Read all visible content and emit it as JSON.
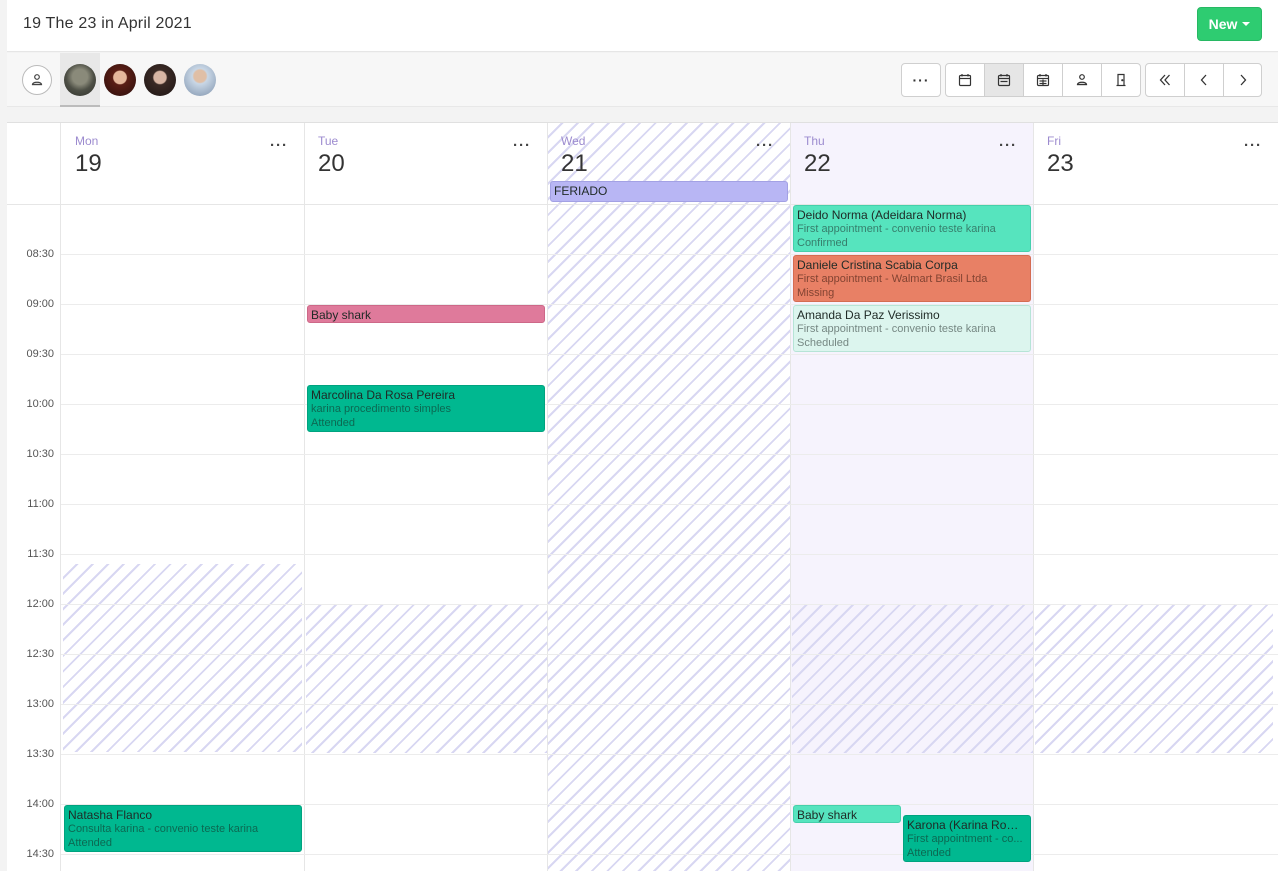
{
  "header": {
    "title": "19 The 23 in April 2021",
    "new_label": "New"
  },
  "toolbar": {
    "more_label": "···",
    "views": [
      {
        "icon": "calendar-day-icon"
      },
      {
        "icon": "calendar-week-icon",
        "selected": true
      },
      {
        "icon": "calendar-month-icon"
      },
      {
        "icon": "professional-view-icon"
      },
      {
        "icon": "room-view-icon"
      }
    ],
    "nav": [
      "double-chevron-left-icon",
      "chevron-left-icon",
      "chevron-right-icon"
    ]
  },
  "calendar": {
    "day_menu": "···",
    "days": [
      {
        "name": "Mon",
        "number": "19"
      },
      {
        "name": "Tue",
        "number": "20"
      },
      {
        "name": "Wed",
        "number": "21"
      },
      {
        "name": "Thu",
        "number": "22"
      },
      {
        "name": "Fri",
        "number": "23"
      }
    ],
    "times": [
      "08:30",
      "09:00",
      "09:30",
      "10:00",
      "10:30",
      "11:00",
      "11:30",
      "12:00",
      "12:30",
      "13:00",
      "13:30",
      "14:00",
      "14:30"
    ],
    "events": {
      "holiday": {
        "title": "FERIADO"
      },
      "deido": {
        "title": "Deido Norma (Adeidara Norma)",
        "detail": "First appointment - convenio teste karina",
        "status": "Confirmed"
      },
      "daniele": {
        "title": "Daniele Cristina Scabia Corpa",
        "detail": "First appointment - Walmart Brasil Ltda",
        "status": "Missing"
      },
      "amanda": {
        "title": "Amanda Da Paz Verissimo",
        "detail": "First appointment - convenio teste karina",
        "status": "Scheduled"
      },
      "baby_tue": {
        "title": "Baby shark"
      },
      "marcolina": {
        "title": "Marcolina Da Rosa Pereira",
        "detail": "karina procedimento simples",
        "status": "Attended"
      },
      "natasha": {
        "title": "Natasha Flanco",
        "detail": "Consulta karina - convenio teste karina",
        "status": "Attended"
      },
      "baby_thu": {
        "title": "Baby shark"
      },
      "karona": {
        "title": "Karona (Karina Romã...",
        "detail": "First appointment - co...",
        "status": "Attended"
      }
    }
  },
  "colors": {
    "accent": "#2ecc71",
    "today_bg": "#f6f3fd",
    "day_name": "#9c8bcf",
    "attended": "#00b890",
    "confirmed": "#56e4be",
    "missing": "#e88065",
    "scheduled": "#dcf5ee",
    "reminder": "#df7a9b",
    "holiday": "#b8b6f4"
  }
}
